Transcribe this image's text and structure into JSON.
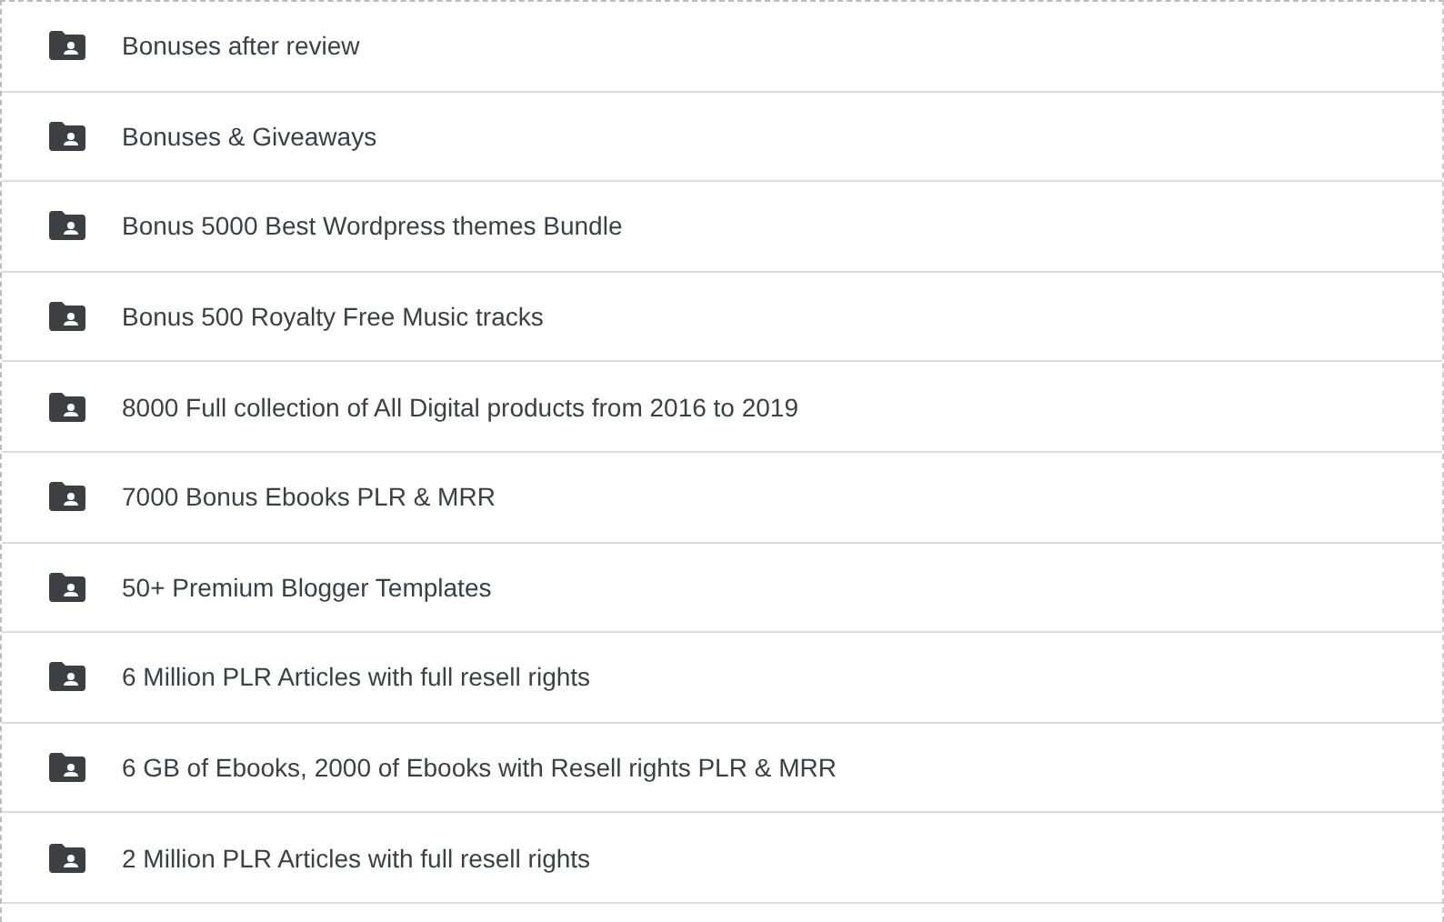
{
  "folders": [
    {
      "name": "Bonuses after review"
    },
    {
      "name": "Bonuses & Giveaways"
    },
    {
      "name": "Bonus 5000 Best Wordpress themes Bundle"
    },
    {
      "name": "Bonus 500 Royalty Free Music tracks"
    },
    {
      "name": "8000 Full collection of All Digital products from 2016 to 2019"
    },
    {
      "name": "7000 Bonus Ebooks PLR & MRR"
    },
    {
      "name": "50+ Premium Blogger Templates"
    },
    {
      "name": "6 Million PLR Articles with full resell rights"
    },
    {
      "name": "6 GB of Ebooks, 2000 of Ebooks with Resell rights PLR & MRR"
    },
    {
      "name": "2 Million PLR Articles with full resell rights"
    }
  ]
}
